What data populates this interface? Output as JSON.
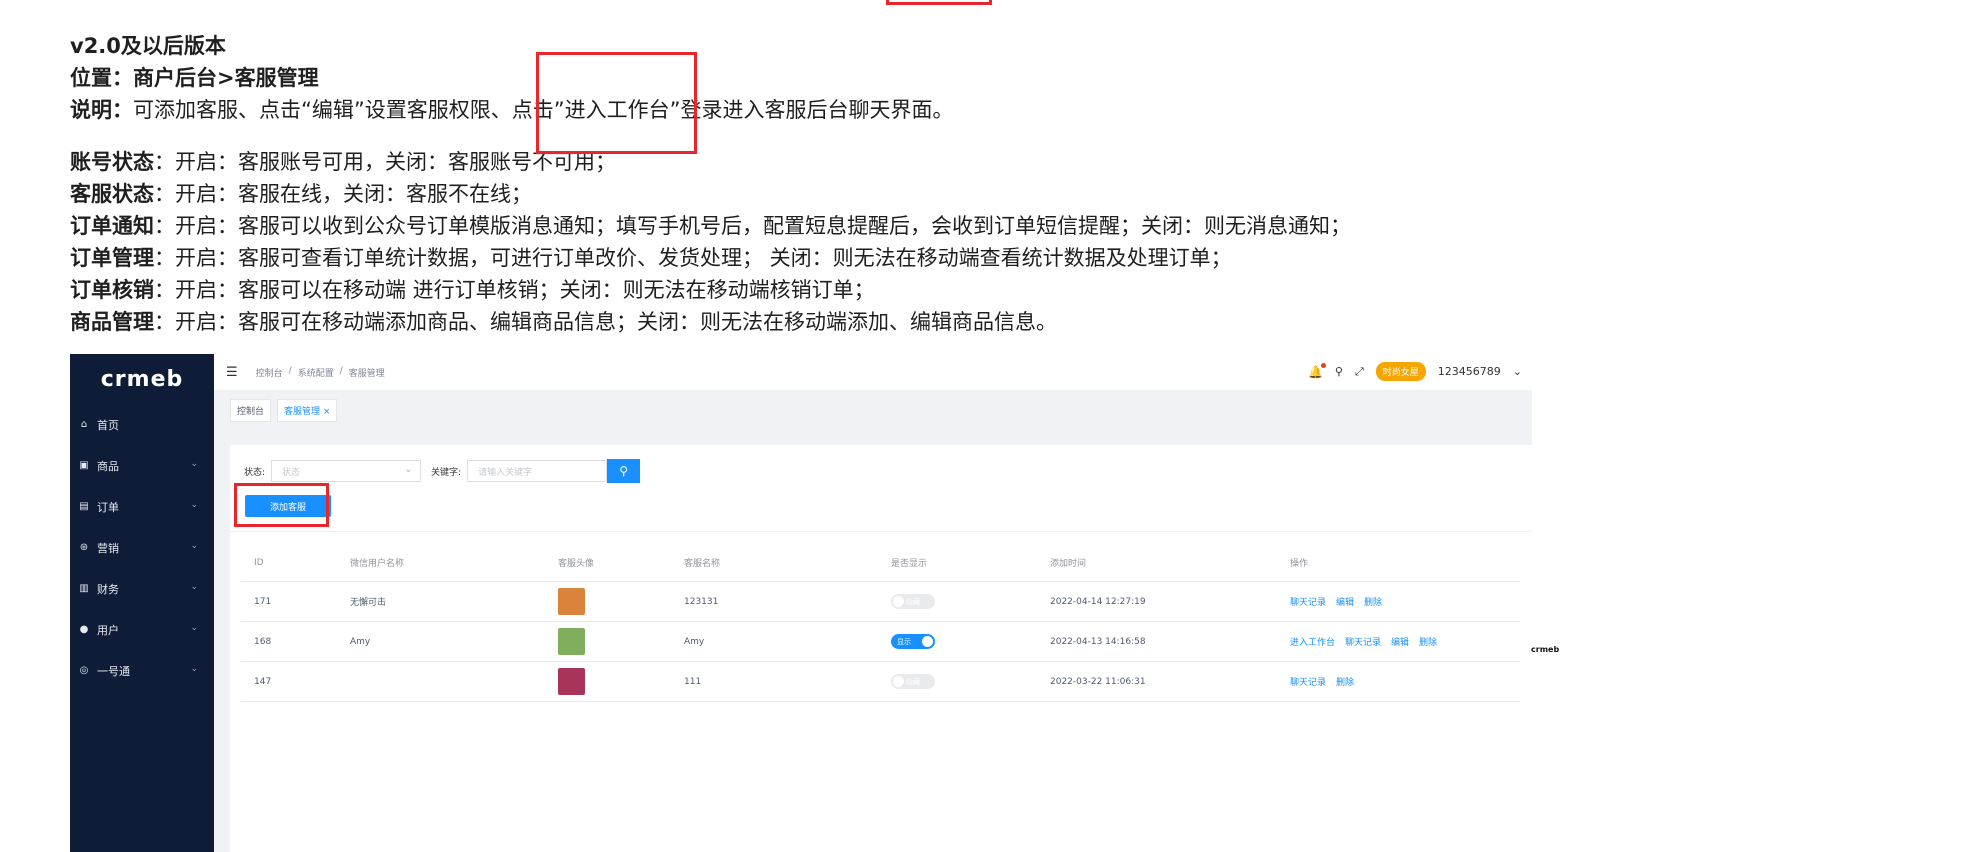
{
  "doc": {
    "version_title": "v2.0及以后版本",
    "location_label": "位置：",
    "location_value": "商户后台>客服管理",
    "desc_label": "说明：",
    "desc_value": "可添加客服、点击“编辑”设置客服权限、点击”进入工作台”登录进入客服后台聊天界面。",
    "rules": [
      {
        "term": "账号状态",
        "text": "：开启：客服账号可用，关闭：客服账号不可用；"
      },
      {
        "term": "客服状态",
        "text": "：开启：客服在线，关闭：客服不在线；"
      },
      {
        "term": "订单通知",
        "text": "：开启：客服可以收到公众号订单模版消息通知；填写手机号后，配置短息提醒后，会收到订单短信提醒；关闭：则无消息通知；"
      },
      {
        "term": "订单管理",
        "text": "：开启：客服可查看订单统计数据，可进行订单改价、发货处理； 关闭：则无法在移动端查看统计数据及处理订单；"
      },
      {
        "term": "订单核销",
        "text": "：开启：客服可以在移动端 进行订单核销；关闭：则无法在移动端核销订单；"
      },
      {
        "term": "商品管理",
        "text": "：开启：客服可在移动端添加商品、编辑商品信息；关闭：则无法在移动端添加、编辑商品信息。"
      }
    ]
  },
  "app": {
    "logo": "crmeb",
    "nav": [
      {
        "label": "首页",
        "icon": "home-icon",
        "glyph": "⌂"
      },
      {
        "label": "商品",
        "icon": "bag-icon",
        "glyph": "▣"
      },
      {
        "label": "订单",
        "icon": "clipboard-icon",
        "glyph": "▤"
      },
      {
        "label": "营销",
        "icon": "aperture-icon",
        "glyph": "⊛"
      },
      {
        "label": "财务",
        "icon": "bar-chart-icon",
        "glyph": "▥"
      },
      {
        "label": "用户",
        "icon": "user-icon",
        "glyph": "●"
      },
      {
        "label": "一号通",
        "icon": "circle-icon",
        "glyph": "◎"
      }
    ],
    "breadcrumbs": [
      "控制台",
      "/",
      "系统配置",
      "/",
      "客服管理"
    ],
    "username": "123456789",
    "store_badge": "时尚女屋",
    "tabs": [
      {
        "label": "控制台",
        "active": false
      },
      {
        "label": "客服管理 ×",
        "active": true
      }
    ],
    "filter": {
      "status_label": "状态:",
      "status_placeholder": "状态",
      "keyword_label": "关键字:",
      "keyword_placeholder": "请输入关键字"
    },
    "add_button": "添加客服",
    "table": {
      "headers": [
        "ID",
        "微信用户名称",
        "客服头像",
        "客服名称",
        "是否显示",
        "添加时间",
        "操作"
      ],
      "rows": [
        {
          "id": "171",
          "nick": "无懈可击",
          "avatar_color": "#d9843a",
          "name": "123131",
          "show": false,
          "show_label": "隐藏",
          "time": "2022-04-14 12:27:19",
          "ops": [
            "聊天记录",
            "编辑",
            "删除"
          ]
        },
        {
          "id": "168",
          "nick": "Amy",
          "avatar_color": "#7fae5c",
          "name": "Amy",
          "show": true,
          "show_label": "显示",
          "time": "2022-04-13 14:16:58",
          "ops": [
            "进入工作台",
            "聊天记录",
            "编辑",
            "删除"
          ]
        },
        {
          "id": "147",
          "nick": "",
          "avatar_color": "#a8345a",
          "name": "111",
          "show": false,
          "show_label": "隐藏",
          "time": "2022-03-22 11:06:31",
          "ops": [
            "聊天记录",
            "删除"
          ]
        }
      ]
    },
    "corner_logo": "crmeb"
  },
  "colors": {
    "accent": "#1890ff",
    "highlight": "#e8262c",
    "sidebar": "#0f1c38"
  }
}
